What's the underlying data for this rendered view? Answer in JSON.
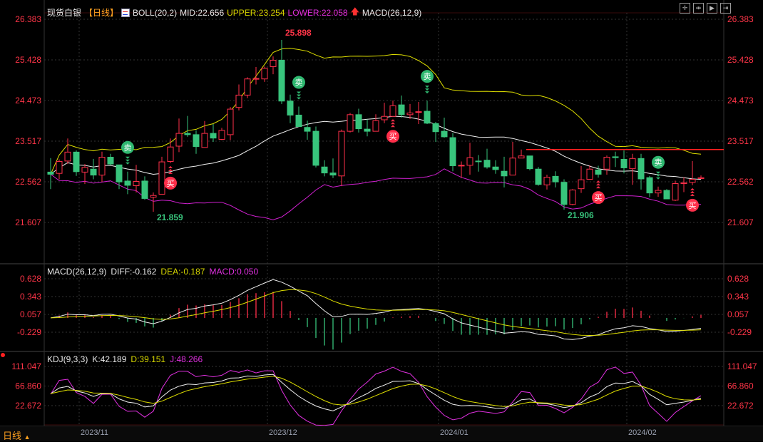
{
  "header": {
    "instrument": "现货白银",
    "period": "【日线】",
    "boll_label": "BOLL(20,2)",
    "mid": "MID:22.656",
    "upper": "UPPER:23.254",
    "lower": "LOWER:22.058",
    "macd_label": "MACD(26,12,9)"
  },
  "macd_header": {
    "title": "MACD(26,12,9)",
    "diff": "DIFF:-0.162",
    "dea": "DEA:-0.187",
    "macd": "MACD:0.050"
  },
  "kdj_header": {
    "title": "KDJ(9,3,3)",
    "k": "K:42.189",
    "d": "D:39.151",
    "j": "J:48.266"
  },
  "toolbar": {
    "buttons": [
      "crosshair",
      "range-select",
      "play",
      "exit"
    ]
  },
  "bottom": {
    "period_label": "日线",
    "arrow": "▲"
  },
  "colors": {
    "up": "#ff2f4a",
    "down": "#38c47c",
    "upper": "#dede00",
    "lower": "#d020d0",
    "mid": "#f0f0f0",
    "bg": "#000000"
  },
  "chart_data": [
    {
      "type": "candlestick",
      "title": "现货白银 日线 BOLL(20,2)",
      "ylim": [
        21.607,
        26.383
      ],
      "yticks": [
        "26.383",
        "25.428",
        "24.473",
        "23.517",
        "22.562",
        "21.607"
      ],
      "xticks": [
        {
          "label": "2023/11",
          "index": 4
        },
        {
          "label": "2023/12",
          "index": 26
        },
        {
          "label": "2024/01",
          "index": 46
        },
        {
          "label": "2024/02",
          "index": 68
        }
      ],
      "ohlc_order": "open,high,low,close",
      "candles": [
        [
          22.79,
          23.12,
          22.39,
          22.74
        ],
        [
          22.76,
          23.09,
          22.62,
          23.04
        ],
        [
          23.05,
          23.58,
          22.98,
          23.26
        ],
        [
          23.26,
          23.3,
          22.7,
          22.8
        ],
        [
          22.79,
          22.98,
          22.51,
          22.9
        ],
        [
          22.86,
          23.1,
          22.62,
          22.72
        ],
        [
          22.72,
          23.27,
          22.56,
          23.14
        ],
        [
          23.14,
          23.22,
          22.95,
          22.98
        ],
        [
          22.96,
          22.96,
          22.39,
          22.56
        ],
        [
          22.58,
          22.8,
          22.27,
          22.48
        ],
        [
          22.47,
          22.96,
          22.31,
          22.57
        ],
        [
          22.58,
          22.69,
          22.14,
          22.17
        ],
        [
          22.2,
          22.31,
          21.859,
          22.24
        ],
        [
          22.27,
          23.15,
          22.27,
          23.03
        ],
        [
          23.04,
          23.58,
          23.0,
          23.38
        ],
        [
          23.4,
          24.05,
          23.26,
          23.7
        ],
        [
          23.7,
          24.11,
          23.62,
          23.67
        ],
        [
          23.67,
          23.77,
          23.22,
          23.39
        ],
        [
          23.37,
          23.99,
          23.37,
          23.7
        ],
        [
          23.7,
          23.92,
          23.5,
          23.59
        ],
        [
          23.56,
          23.83,
          23.54,
          23.77
        ],
        [
          23.67,
          24.32,
          23.54,
          24.27
        ],
        [
          24.31,
          24.85,
          24.24,
          24.6
        ],
        [
          24.6,
          25.02,
          24.53,
          24.98
        ],
        [
          24.98,
          25.26,
          24.85,
          24.99
        ],
        [
          24.98,
          25.27,
          24.91,
          25.23
        ],
        [
          25.27,
          25.51,
          25.09,
          25.42
        ],
        [
          25.42,
          25.898,
          24.39,
          24.46
        ],
        [
          24.46,
          24.61,
          23.94,
          24.13
        ],
        [
          24.13,
          24.33,
          23.86,
          23.86
        ],
        [
          23.84,
          24.0,
          23.55,
          23.75
        ],
        [
          23.75,
          23.86,
          22.9,
          22.95
        ],
        [
          22.91,
          23.07,
          22.69,
          22.77
        ],
        [
          22.77,
          23.11,
          22.65,
          22.72
        ],
        [
          22.7,
          23.79,
          22.46,
          23.75
        ],
        [
          23.75,
          24.18,
          23.72,
          24.14
        ],
        [
          24.14,
          24.28,
          23.72,
          23.81
        ],
        [
          23.8,
          24.03,
          23.63,
          23.75
        ],
        [
          23.75,
          24.15,
          23.75,
          24.0
        ],
        [
          24.02,
          24.42,
          23.94,
          24.1
        ],
        [
          24.1,
          24.47,
          24.1,
          24.35
        ],
        [
          24.37,
          24.59,
          24.07,
          24.14
        ],
        [
          24.14,
          24.39,
          24.04,
          24.18
        ],
        [
          24.2,
          24.44,
          23.92,
          24.21
        ],
        [
          24.22,
          24.47,
          23.92,
          23.94
        ],
        [
          23.93,
          23.97,
          23.5,
          23.74
        ],
        [
          23.75,
          24.07,
          23.6,
          23.62
        ],
        [
          23.6,
          23.71,
          22.81,
          22.94
        ],
        [
          22.94,
          23.04,
          22.65,
          22.95
        ],
        [
          22.95,
          23.48,
          22.73,
          23.13
        ],
        [
          23.05,
          23.19,
          22.8,
          23.04
        ],
        [
          23.07,
          23.34,
          22.87,
          22.91
        ],
        [
          22.91,
          23.07,
          22.75,
          22.85
        ],
        [
          22.81,
          23.15,
          22.43,
          22.7
        ],
        [
          22.72,
          23.5,
          22.72,
          23.12
        ],
        [
          23.12,
          23.32,
          23.12,
          23.17
        ],
        [
          23.17,
          23.17,
          22.83,
          22.87
        ],
        [
          22.86,
          22.91,
          22.47,
          22.5
        ],
        [
          22.49,
          22.73,
          22.38,
          22.67
        ],
        [
          22.69,
          22.81,
          22.43,
          22.56
        ],
        [
          22.55,
          22.62,
          21.906,
          22.03
        ],
        [
          22.03,
          22.39,
          22.01,
          22.37
        ],
        [
          22.4,
          22.93,
          22.3,
          22.61
        ],
        [
          22.62,
          22.95,
          22.61,
          22.86
        ],
        [
          22.84,
          22.94,
          22.66,
          22.74
        ],
        [
          22.86,
          23.18,
          22.73,
          23.14
        ],
        [
          23.15,
          23.27,
          22.91,
          23.13
        ],
        [
          23.09,
          23.3,
          22.76,
          22.89
        ],
        [
          22.87,
          23.22,
          22.49,
          23.11
        ],
        [
          23.11,
          23.22,
          22.38,
          22.63
        ],
        [
          22.66,
          22.7,
          22.2,
          22.3
        ],
        [
          22.3,
          22.45,
          22.21,
          22.36
        ],
        [
          22.36,
          22.39,
          22.16,
          22.16
        ],
        [
          22.13,
          22.59,
          22.11,
          22.52
        ],
        [
          22.52,
          22.67,
          22.32,
          22.54
        ],
        [
          22.55,
          23.05,
          22.48,
          22.62
        ],
        [
          22.64,
          22.71,
          22.63,
          22.656
        ]
      ],
      "annotations": [
        {
          "text": "25.898",
          "index": 27,
          "kind": "high"
        },
        {
          "text": "21.859",
          "index": 12,
          "kind": "low"
        },
        {
          "text": "21.906",
          "index": 60,
          "kind": "low"
        }
      ],
      "signals": [
        {
          "label": "卖",
          "type": "sell",
          "index": 9
        },
        {
          "label": "卖",
          "type": "sell",
          "index": 29
        },
        {
          "label": "卖",
          "type": "sell",
          "index": 44
        },
        {
          "label": "卖",
          "type": "sell",
          "index": 71
        },
        {
          "label": "买",
          "type": "buy",
          "index": 14
        },
        {
          "label": "买",
          "type": "buy",
          "index": 40
        },
        {
          "label": "买",
          "type": "buy",
          "index": 64
        },
        {
          "label": "买",
          "type": "buy",
          "index": 75
        }
      ],
      "resistance_line": {
        "price": 23.32,
        "from_index": 56
      },
      "boll": {
        "period": 20,
        "k": 2
      }
    },
    {
      "type": "macd",
      "params": [
        26,
        12,
        9
      ],
      "ylim": [
        -0.229,
        0.628
      ],
      "yticks": [
        "0.628",
        "0.343",
        "0.057",
        "-0.229"
      ]
    },
    {
      "type": "kdj",
      "params": [
        9,
        3,
        3
      ],
      "ylim": [
        22.672,
        111.047
      ],
      "yticks": [
        "111.047",
        "66.860",
        "22.672"
      ]
    }
  ]
}
